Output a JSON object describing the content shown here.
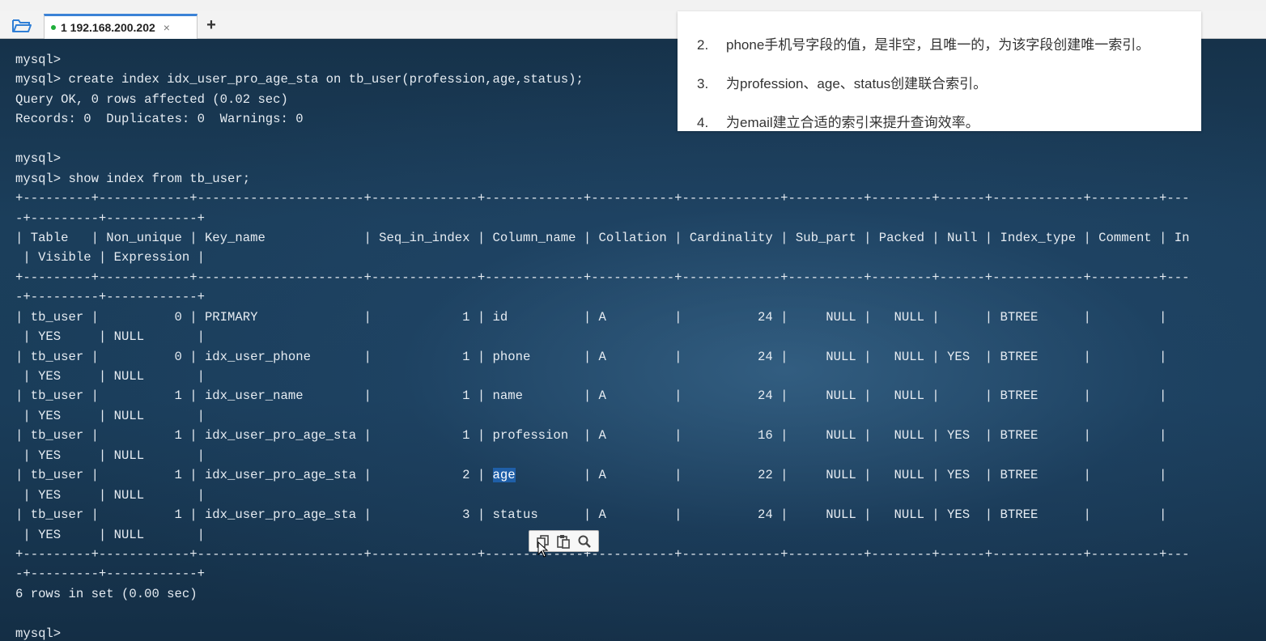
{
  "tabs": [
    {
      "label": "1 192.168.200.202",
      "close": "×",
      "status_color": "#1fae3a",
      "active": true
    }
  ],
  "add_tab_label": "+",
  "icons": {
    "folder": "folder-icon",
    "copy": "copy-icon",
    "paste": "paste-icon",
    "search": "search-icon"
  },
  "terminal": {
    "lines": [
      "mysql>",
      "mysql> create index idx_user_pro_age_sta on tb_user(profession,age,status);",
      "Query OK, 0 rows affected (0.02 sec)",
      "Records: 0  Duplicates: 0  Warnings: 0",
      "",
      "mysql>",
      "mysql> show index from tb_user;",
      "+---------+------------+----------------------+--------------+-------------+-----------+-------------+----------+--------+------+------------+---------+---",
      "-+---------+------------+",
      "| Table   | Non_unique | Key_name             | Seq_in_index | Column_name | Collation | Cardinality | Sub_part | Packed | Null | Index_type | Comment | In",
      " | Visible | Expression |",
      "+---------+------------+----------------------+--------------+-------------+-----------+-------------+----------+--------+------+------------+---------+---",
      "-+---------+------------+",
      "| tb_user |          0 | PRIMARY              |            1 | id          | A         |          24 |     NULL |   NULL |      | BTREE      |         |",
      " | YES     | NULL       |",
      "| tb_user |          0 | idx_user_phone       |            1 | phone       | A         |          24 |     NULL |   NULL | YES  | BTREE      |         |",
      " | YES     | NULL       |",
      "| tb_user |          1 | idx_user_name        |            1 | name        | A         |          24 |     NULL |   NULL |      | BTREE      |         |",
      " | YES     | NULL       |",
      "| tb_user |          1 | idx_user_pro_age_sta |            1 | profession  | A         |          16 |     NULL |   NULL | YES  | BTREE      |         |",
      " | YES     | NULL       |",
      "| tb_user |          1 | idx_user_pro_age_sta |            2 | ",
      " | YES     | NULL       |",
      "| tb_user |          1 | idx_user_pro_age_sta |            3 | status      | A         |          24 |     NULL |   NULL | YES  | BTREE      |         |",
      " | YES     | NULL       |",
      "+---------+------------+----------------------+--------------+-------------+-----------+-------------+----------+--------+------+------------+---------+---",
      "-+---------+------------+",
      "6 rows in set (0.00 sec)",
      "",
      "mysql>"
    ],
    "selected_text": "age",
    "after_selection": "         | A         |          22 |     NULL |   NULL | YES  | BTREE      |         |"
  },
  "panel": {
    "items": [
      {
        "num": "2.",
        "text": "phone手机号字段的值，是非空，且唯一的，为该字段创建唯一索引。"
      },
      {
        "num": "3.",
        "text": "为profession、age、status创建联合索引。"
      },
      {
        "num": "4.",
        "text": "为email建立合适的索引来提升查询效率。"
      }
    ]
  }
}
